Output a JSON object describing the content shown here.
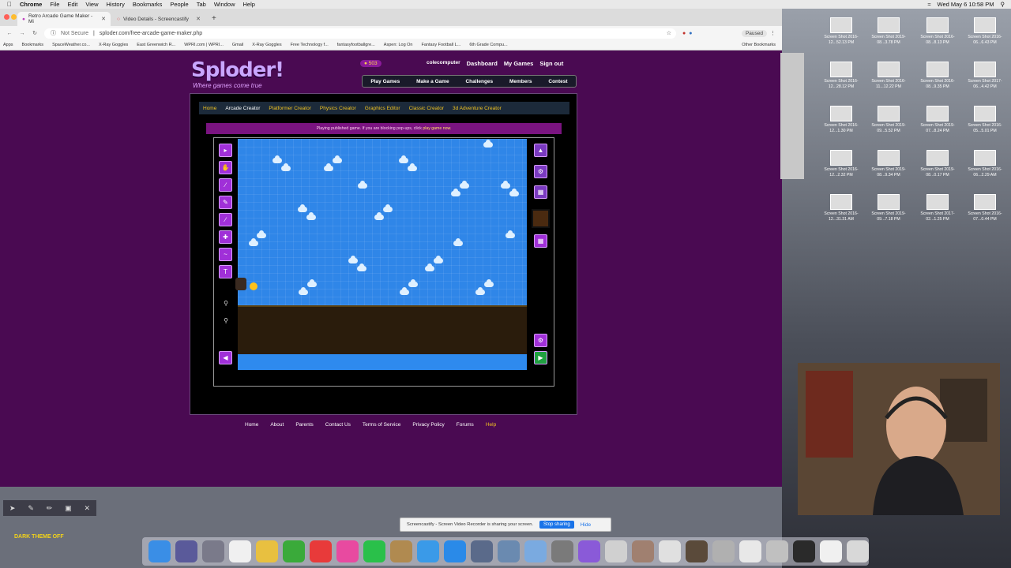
{
  "menubar": {
    "app": "Chrome",
    "items": [
      "File",
      "Edit",
      "View",
      "History",
      "Bookmarks",
      "People",
      "Tab",
      "Window",
      "Help"
    ],
    "clock": "Wed May 6  10:58 PM"
  },
  "browser": {
    "tabs": [
      {
        "title": "Retro Arcade Game Maker - Mi"
      },
      {
        "title": "Video Details - Screencastify"
      }
    ],
    "security": "Not Secure",
    "url": "sploder.com/free-arcade-game-maker.php",
    "profile_status": "Paused",
    "bookmarks": [
      "Apps",
      "Bookmarks",
      "SpaceWeather.co...",
      "X-Ray Goggles",
      "East Greenwich R...",
      "WPRI.com | WPRI...",
      "Gmail",
      "X-Ray Goggles",
      "Free Technology f...",
      "fantasyfootballgre...",
      "Aspen: Log On",
      "Fantasy Football L...",
      "6th Grade Compu..."
    ],
    "other_bookmarks": "Other Bookmarks"
  },
  "site": {
    "logo": "Sploder!",
    "tagline": "Where games come true",
    "coins": "503",
    "username": "colecomputer",
    "user_links": [
      "Dashboard",
      "My Games",
      "Sign out"
    ],
    "main_nav": [
      "Play Games",
      "Make a Game",
      "Challenges",
      "Members",
      "Contest"
    ],
    "sub_nav": [
      "Home",
      "Arcade Creator",
      "Platformer Creator",
      "Physics Creator",
      "Graphics Editor",
      "Classic Creator",
      "3d Adventure Creator"
    ],
    "notice": "Playing published game. If you are blocking pop-ups, click",
    "notice_link": "play game now.",
    "footer": [
      "Home",
      "About",
      "Parents",
      "Contact Us",
      "Terms of Service",
      "Privacy Policy",
      "Forums",
      "Help"
    ]
  },
  "screencastify": {
    "dark_theme": "DARK THEME OFF",
    "share_text": "Screencastify - Screen Video Recorder is sharing your screen.",
    "stop_label": "Stop sharing",
    "hide_label": "Hide"
  },
  "desktop_files": [
    "Screen Shot 2016-12...52.13 PM",
    "Screen Shot 2019-08...3.78 PM",
    "Screen Shot 2016-08...8.13 PM",
    "Screen Shot 2016-06...6.43 PM",
    "Screen Shot 2016-12...28.12 PM",
    "Screen Shot 2016-11...12.22 PM",
    "Screen Shot 2016-08...9.35 PM",
    "Screen Shot 2017-06...4.42 PM",
    "Screen Shot 2016-12...1.30 PM",
    "Screen Shot 2019-09...5.52 PM",
    "Screen Shot 2019-07...8.24 PM",
    "Screen Shot 2016-05...5.01 PM",
    "Screen Shot 2016-12...2.32 PM",
    "Screen Shot 2019-08...9.34 PM",
    "Screen Shot 2019-08...0.17 PM",
    "Screen Shot 2016-06...2.29 AM",
    "Screen Shot 2016-12...31.31 AM",
    "Screen Shot 2019-09...7.18 PM",
    "Screen Shot 2017-02...1.25 PM",
    "Screen Shot 2016-07...0.44 PM"
  ]
}
